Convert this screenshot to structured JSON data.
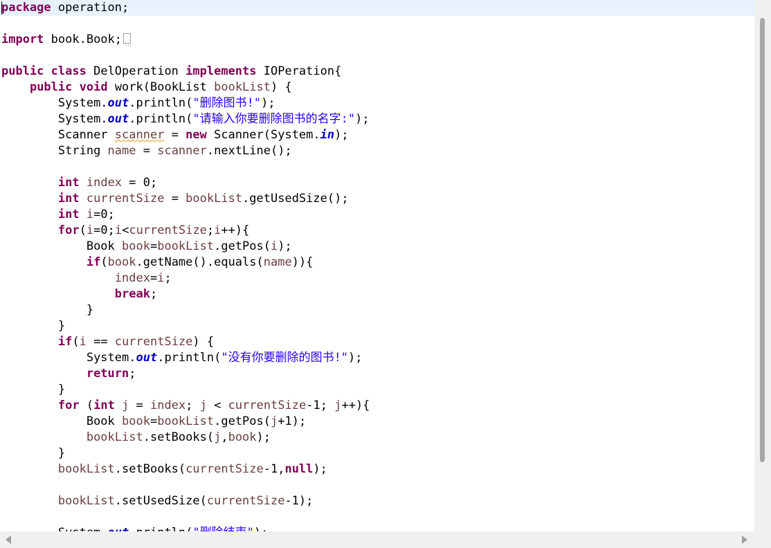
{
  "code": {
    "line1": {
      "kw": "package",
      "rest": " operation;"
    },
    "line3": {
      "kw": "import",
      "rest": " book.Book;"
    },
    "line5": {
      "kw1": "public",
      "kw2": "class",
      "name": " DelOperation ",
      "kw3": "implements",
      "rest": " IOPeration{"
    },
    "line6": {
      "indent": "    ",
      "kw1": "public",
      "kw2": "void",
      "rest1": " work(BookList ",
      "param": "bookList",
      "rest2": ") {"
    },
    "line7": {
      "indent": "        ",
      "a": "System.",
      "out": "out",
      "b": ".println(",
      "str": "\"删除图书!\"",
      "c": ");"
    },
    "line8": {
      "indent": "        ",
      "a": "System.",
      "out": "out",
      "b": ".println(",
      "str": "\"请输入你要删除图书的名字:\"",
      "c": ");"
    },
    "line9": {
      "indent": "        ",
      "a": "Scanner ",
      "warnvar": "scanner",
      "b": " = ",
      "kw": "new",
      "c": " Scanner(System.",
      "in": "in",
      "d": ");"
    },
    "line10": {
      "indent": "        ",
      "a": "String ",
      "v1": "name",
      "b": " = ",
      "v2": "scanner",
      "c": ".nextLine();"
    },
    "line12": {
      "indent": "        ",
      "kw": "int",
      "sp": " ",
      "v": "index",
      "rest": " = 0;"
    },
    "line13": {
      "indent": "        ",
      "kw": "int",
      "sp": " ",
      "v": "currentSize",
      "b": " = ",
      "v2": "bookList",
      "rest": ".getUsedSize();"
    },
    "line14": {
      "indent": "        ",
      "kw": "int",
      "sp": " ",
      "v": "i",
      "rest": "=0;"
    },
    "line15": {
      "indent": "        ",
      "kw": "for",
      "a": "(",
      "v1": "i",
      "b": "=0;",
      "v2": "i",
      "c": "<",
      "v3": "currentSize",
      "d": ";",
      "v4": "i",
      "e": "++){"
    },
    "line16": {
      "indent": "            ",
      "a": "Book ",
      "v1": "book",
      "b": "=",
      "v2": "bookList",
      "c": ".getPos(",
      "v3": "i",
      "d": ");"
    },
    "line17": {
      "indent": "            ",
      "kw": "if",
      "a": "(",
      "v1": "book",
      "b": ".getName().equals(",
      "v2": "name",
      "c": ")){"
    },
    "line18": {
      "indent": "                ",
      "v1": "index",
      "a": "=",
      "v2": "i",
      "b": ";"
    },
    "line19": {
      "indent": "                ",
      "kw": "break",
      "a": ";"
    },
    "line20": {
      "text": "            }"
    },
    "line21": {
      "text": "        }"
    },
    "line22": {
      "indent": "        ",
      "kw": "if",
      "a": "(",
      "v1": "i",
      "b": " == ",
      "v2": "currentSize",
      "c": ") {"
    },
    "line23": {
      "indent": "            ",
      "a": "System.",
      "out": "out",
      "b": ".println(",
      "str": "\"没有你要删除的图书!\"",
      "c": ");"
    },
    "line24": {
      "indent": "            ",
      "kw": "return",
      "a": ";"
    },
    "line25": {
      "text": "        }"
    },
    "line26": {
      "indent": "        ",
      "kw": "for",
      "a": " (",
      "kw2": "int",
      "sp": " ",
      "v1": "j",
      "b": " = ",
      "v2": "index",
      "c": "; ",
      "v3": "j",
      "d": " < ",
      "v4": "currentSize",
      "e": "-1; ",
      "v5": "j",
      "f": "++){"
    },
    "line27": {
      "indent": "            ",
      "a": "Book ",
      "v1": "book",
      "b": "=",
      "v2": "bookList",
      "c": ".getPos(",
      "v3": "j",
      "d": "+1);"
    },
    "line28": {
      "indent": "            ",
      "v1": "bookList",
      "a": ".setBooks(",
      "v2": "j",
      "b": ",",
      "v3": "book",
      "c": ");"
    },
    "line29": {
      "text": "        }"
    },
    "line30": {
      "indent": "        ",
      "v1": "bookList",
      "a": ".setBooks(",
      "v2": "currentSize",
      "b": "-1,",
      "kw": "null",
      "c": ");"
    },
    "line32": {
      "indent": "        ",
      "v1": "bookList",
      "a": ".setUsedSize(",
      "v2": "currentSize",
      "b": "-1);"
    },
    "line34": {
      "indent": "        ",
      "a": "System.",
      "out": "out",
      "b": ".println(",
      "str": "\"删除结束\"",
      "c": ");"
    }
  },
  "colors": {
    "keyword": "#7f0055",
    "field": "#0000c0",
    "string": "#2a00ff",
    "local_variable": "#6a3e3e",
    "current_line": "#e8f2fe"
  }
}
